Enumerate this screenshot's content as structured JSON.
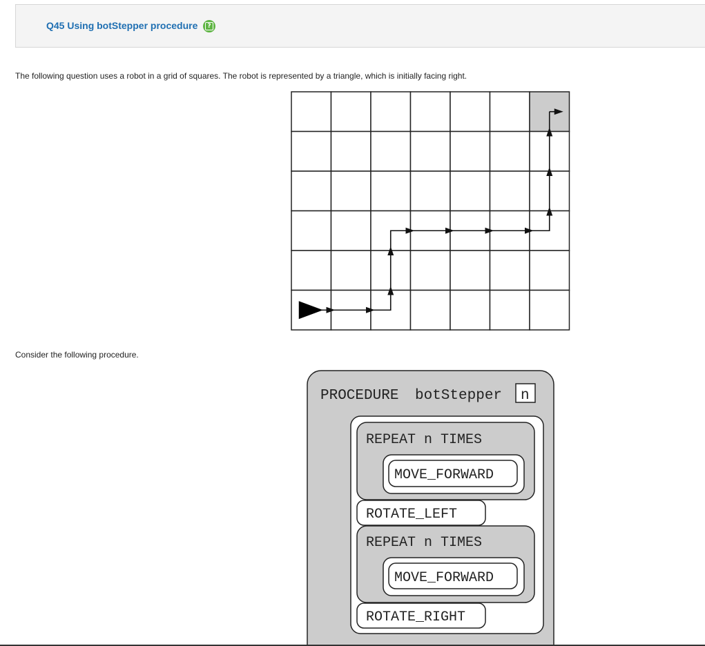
{
  "question": {
    "title": "Q45 Using botStepper procedure",
    "help_icon": "question-mark-icon",
    "help_color": "#5fb544",
    "title_color": "#1f6fb2"
  },
  "prompt_1": "The following question uses a robot in a grid of squares. The robot is represented by a triangle, which is initially facing right.",
  "grid": {
    "rows": 6,
    "cols": 7,
    "start": {
      "row": 6,
      "col": 1,
      "facing": "right"
    },
    "goal": {
      "row": 1,
      "col": 7,
      "shaded": true
    },
    "path": [
      [
        6,
        1
      ],
      [
        6,
        2
      ],
      [
        6,
        3
      ],
      [
        5,
        3
      ],
      [
        4,
        3
      ],
      [
        4,
        4
      ],
      [
        4,
        5
      ],
      [
        4,
        6
      ],
      [
        4,
        7
      ],
      [
        3,
        7
      ],
      [
        2,
        7
      ],
      [
        1,
        7
      ]
    ]
  },
  "prompt_2": "Consider the following procedure.",
  "procedure": {
    "header_keyword": "PROCEDURE",
    "name": "botStepper",
    "param": "n",
    "blocks": [
      {
        "type": "repeat",
        "label": "REPEAT n TIMES",
        "body": "MOVE_FORWARD"
      },
      {
        "type": "command",
        "label": "ROTATE_LEFT"
      },
      {
        "type": "repeat",
        "label": "REPEAT n TIMES",
        "body": "MOVE_FORWARD"
      },
      {
        "type": "command",
        "label": "ROTATE_RIGHT"
      }
    ]
  }
}
